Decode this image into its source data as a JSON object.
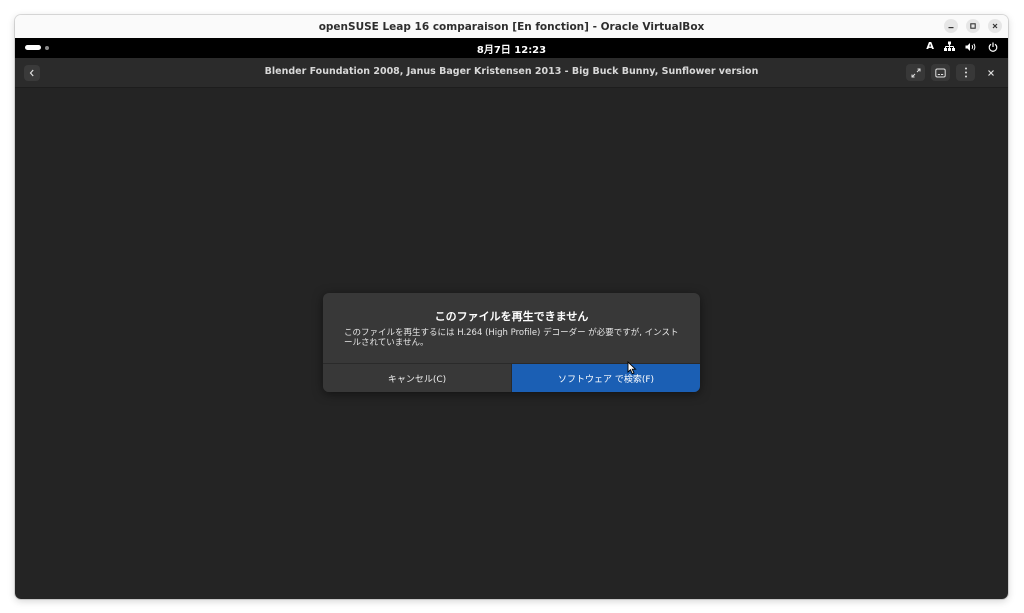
{
  "vbox": {
    "title": "openSUSE Leap 16 comparaison [En fonction] - Oracle VirtualBox",
    "controls": {
      "minimize": "–",
      "maximize": "□",
      "close": "×"
    }
  },
  "topbar": {
    "clock": "8月7日  12:23",
    "input_method": "A",
    "icons": [
      "network-icon",
      "volume-icon",
      "power-icon"
    ]
  },
  "player": {
    "title": "Blender Foundation 2008, Janus Bager Kristensen 2013 - Big Buck Bunny, Sunflower version",
    "header_buttons": [
      "fullscreen-icon",
      "subtitles-icon",
      "menu-icon",
      "close-icon"
    ]
  },
  "dialog": {
    "heading": "このファイルを再生できません",
    "body": "このファイルを再生するには H.264 (High Profile) デコーダー が必要ですが, インストールされていません。",
    "cancel_label": "キャンセル(C)",
    "search_label": "ソフトウェア で検索(F)"
  },
  "colors": {
    "topbar": "#000000",
    "player_bg": "#242424",
    "dialog_bg": "#383838",
    "accent": "#1b5fb4"
  }
}
